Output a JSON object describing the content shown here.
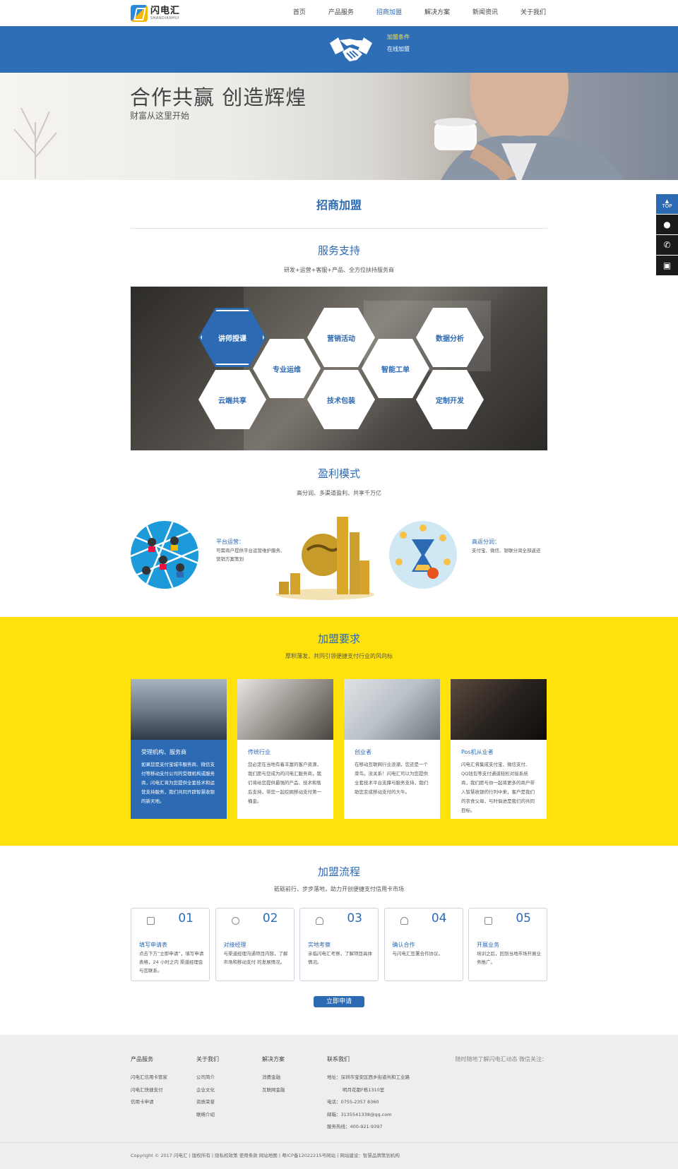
{
  "header": {
    "logo_cn": "闪电汇",
    "logo_en": "SHANDIANHUI",
    "nav": [
      "首页",
      "产品服务",
      "招商加盟",
      "解决方案",
      "新闻资讯",
      "关于我们"
    ],
    "active_nav": "招商加盟"
  },
  "subnav": [
    "加盟条件",
    "在线加盟"
  ],
  "hero": {
    "title": "合作共赢 创造辉煌",
    "subtitle": "财富从这里开始"
  },
  "main_title": "招商加盟",
  "service": {
    "title": "服务支持",
    "desc": "研发+运营+客服+产品、全方位扶持服务商",
    "hexes": [
      "讲师授课",
      "营销活动",
      "数据分析",
      "专业运维",
      "智能工单",
      "云端共享",
      "技术包装",
      "定制开发"
    ]
  },
  "profit": {
    "title": "盈利模式",
    "desc": "高分润、多渠道盈利、共享千万亿",
    "left_title": "平台运营：",
    "left_desc_1": "可需商户提供平台运营维护服务、",
    "left_desc_2": "营销方案策划",
    "right_title": "高返分润：",
    "right_desc": "支付宝、微信、银联分润全部返还"
  },
  "requirements": {
    "title": "加盟要求",
    "desc": "厚积薄发、共同引领便捷支付行业的风向标",
    "cards": [
      {
        "title": "受理机构、服务商",
        "desc": "如果您是支付宝城市服务商、微信支付等移动支付公司的受理机构或服务商，闪电汇将为您提供全套技术和运营支持服务，我们共同开辟智慧收银的新天地。"
      },
      {
        "title": "传统行业",
        "desc": "您必定在当地有着丰富的客户资源，我们愿与您成为的闪电汇服务商，我们将给您提供最强的产品、技术和售后支持，带您一起挖掘移动支付第一桶金。"
      },
      {
        "title": "创业者",
        "desc": "在移动互联网行业浪潮，您还是一个菜鸟，没关系！闪电汇可以为您提供全套技术平台支撑与服务支持，我们助您变成移动支付的大牛。"
      },
      {
        "title": "Pos机从业者",
        "desc": "闪电汇将集成支付宝、微信支付、QQ钱包等支付通道轻松对接系统商，我们愿与你一起将更多的商户带入智慧收银的行列中来，客户是我们的衣食父母，与时俱进是我们的共同目标。"
      }
    ]
  },
  "process": {
    "title": "加盟流程",
    "desc": "砥砺前行、步步落地，助力开创便捷支付信用卡市场",
    "steps": [
      {
        "num": "01",
        "title": "填写申请表",
        "desc": "点击下方“立即申请”，填写申请表格，24 小时之内 渠道经理会与您联系。"
      },
      {
        "num": "02",
        "title": "对接经理",
        "desc": "与渠道经理沟通项目内容，了解市场和移动支付 的发展情况。"
      },
      {
        "num": "03",
        "title": "实地考察",
        "desc": "亲临闪电汇考察，了解项目具体情况。"
      },
      {
        "num": "04",
        "title": "确认合作",
        "desc": "与闪电汇签署合作协议。"
      },
      {
        "num": "05",
        "title": "开展业务",
        "desc": "培训之后，回到当地市场开展业务推广。"
      }
    ],
    "apply": "立即申请"
  },
  "footer": {
    "col1": {
      "title": "产品服务",
      "items": [
        "闪电汇信用卡管家",
        "闪电汇快捷支付",
        "信用卡申请"
      ]
    },
    "col2": {
      "title": "关于我们",
      "items": [
        "公司简介",
        "企业文化",
        "资质荣誉",
        "联络介绍"
      ]
    },
    "col3": {
      "title": "解决方案",
      "items": [
        "消费金融",
        "互联网金融"
      ]
    },
    "col4": {
      "title": "联系我们",
      "items": [
        "地址：深圳市宝安区西乡街道共和工业路",
        "明月花都F栋1310室",
        "电话：0755-2357 8360",
        "邮箱：3135541338@qq.com",
        "服务热线：400-921-9397"
      ]
    },
    "follow": "随时随地了解闪电汇动态 微信关注：",
    "copyright": "Copyright © 2017 闪电汇   |   版权所有   |   隐私权政策   使用条款   网站地图   |   粤ICP备12022215号网站   |   网站建设：智慧品牌策划机构"
  },
  "side": {
    "top_label": "TOP"
  },
  "colors": {
    "brand_blue": "#2c6ab4",
    "band_blue": "#2d6eb7",
    "yellow": "#ffe20b"
  }
}
